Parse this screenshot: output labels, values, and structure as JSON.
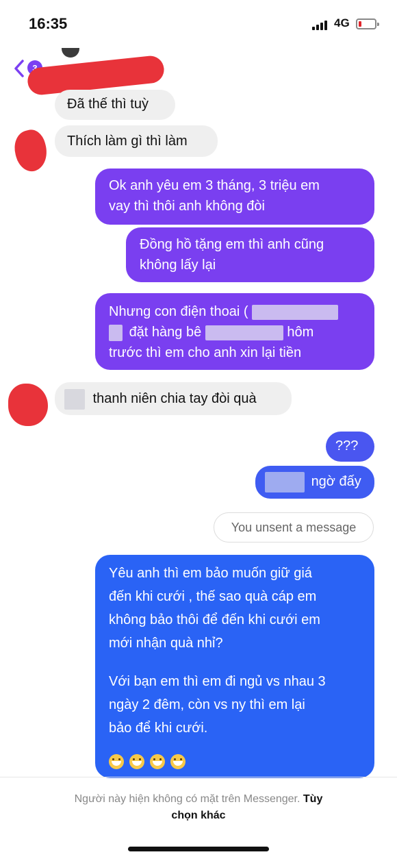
{
  "status_bar": {
    "time": "16:35",
    "network": "4G"
  },
  "header": {
    "unread_count": "3"
  },
  "messages": [
    {
      "id": "m1",
      "side": "in",
      "text": "Đã thế thì tuỳ"
    },
    {
      "id": "m2",
      "side": "in",
      "text": "Thích làm gì thì làm"
    },
    {
      "id": "m3",
      "side": "out",
      "lines": [
        "Ok anh yêu em 3 tháng, 3 triệu em",
        "vay thì thôi anh không đòi"
      ]
    },
    {
      "id": "m4",
      "side": "out",
      "lines": [
        "Đồng hồ tặng em thì anh cũng",
        "không lấy lại"
      ]
    },
    {
      "id": "m5",
      "side": "out",
      "lines": [
        "Nhưng con điện thoai (",
        "đặt hàng bê",
        "hôm",
        "trước thì em cho anh xin lại tiền"
      ]
    },
    {
      "id": "m6",
      "side": "in",
      "text": "thanh niên chia tay đòi quà"
    },
    {
      "id": "m7",
      "side": "out",
      "text": "???"
    },
    {
      "id": "m8",
      "side": "out",
      "text": "ngờ đấy"
    },
    {
      "id": "m9",
      "side": "out",
      "lines": [
        "Yêu anh thì em bảo muốn giữ giá",
        "đến khi cưới , thế sao quà cáp em",
        "không bảo thôi để đến khi cưới em",
        "mới nhận quà nhỉ?",
        "Với bạn em thì em đi ngủ vs nhau 3",
        "ngày 2 đêm, còn vs ny thì em lại",
        "bảo để khi cưới."
      ]
    }
  ],
  "unsent_notice": "You unsent a message",
  "footer": {
    "text": "Người này hiện không có mặt trên Messenger.",
    "link_part1": "Tùy",
    "link_part2": "chọn khác"
  },
  "colors": {
    "purple": "#7a3ff0",
    "blue": "#2a63f5",
    "incoming": "#efefef",
    "redaction": "#e8333a"
  }
}
